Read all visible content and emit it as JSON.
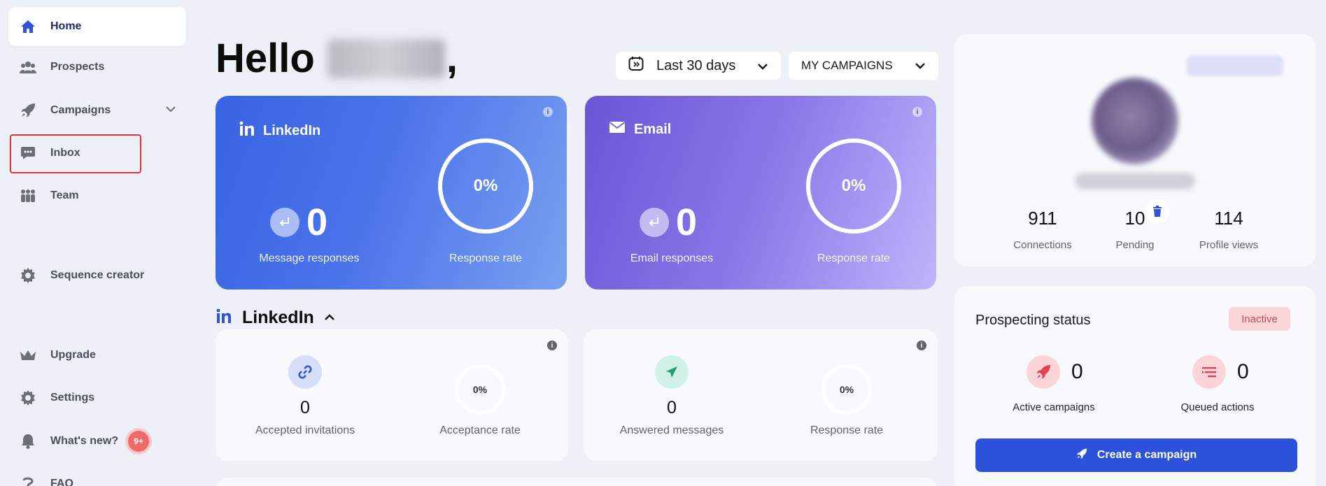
{
  "sidebar": {
    "items": [
      {
        "label": "Home"
      },
      {
        "label": "Prospects"
      },
      {
        "label": "Campaigns"
      },
      {
        "label": "Inbox"
      },
      {
        "label": "Team"
      },
      {
        "label": "Sequence creator"
      },
      {
        "label": "Upgrade"
      },
      {
        "label": "Settings"
      },
      {
        "label": "What's new?",
        "badge": "9+"
      },
      {
        "label": "FAQ"
      }
    ]
  },
  "header": {
    "greeting": "Hello",
    "comma": ",",
    "date_filter": "Last 30 days",
    "campaign_filter": "MY CAMPAIGNS"
  },
  "cards": {
    "linkedin": {
      "title": "LinkedIn",
      "responses_value": "0",
      "responses_label": "Message responses",
      "rate_value": "0%",
      "rate_label": "Response rate"
    },
    "email": {
      "title": "Email",
      "responses_value": "0",
      "responses_label": "Email responses",
      "rate_value": "0%",
      "rate_label": "Response rate"
    }
  },
  "linkedin_section": {
    "title": "LinkedIn",
    "accepted_invitations": {
      "value": "0",
      "label": "Accepted invitations"
    },
    "acceptance_rate": {
      "value": "0%",
      "label": "Acceptance rate"
    },
    "answered_messages": {
      "value": "0",
      "label": "Answered messages"
    },
    "response_rate": {
      "value": "0%",
      "label": "Response rate"
    }
  },
  "profile": {
    "connections": {
      "value": "911",
      "label": "Connections"
    },
    "pending": {
      "value": "10",
      "label": "Pending"
    },
    "profile_views": {
      "value": "114",
      "label": "Profile views"
    }
  },
  "prospecting": {
    "title": "Prospecting status",
    "status": "Inactive",
    "active_campaigns": {
      "value": "0",
      "label": "Active campaigns"
    },
    "queued_actions": {
      "value": "0",
      "label": "Queued actions"
    },
    "create_button": "Create a campaign"
  },
  "colors": {
    "accent": "#2c52dc",
    "linkedin_blue": "#2f55d4",
    "danger": "#d9343c"
  }
}
